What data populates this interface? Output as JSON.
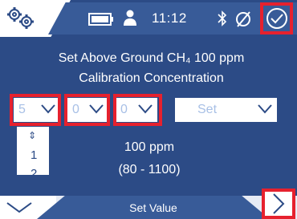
{
  "status_bar": {
    "time": "11:12",
    "icons": [
      "settings-gears-icon",
      "battery-icon",
      "user-icon",
      "bluetooth-icon",
      "no-signal-icon",
      "confirm-check-icon"
    ]
  },
  "message": {
    "line1": "Set Above Ground CH₄ 100 ppm",
    "line2": "Calibration Concentration"
  },
  "dropdowns": [
    {
      "value": "5"
    },
    {
      "value": "0"
    },
    {
      "value": "0"
    },
    {
      "value": "Set"
    }
  ],
  "digit_list": {
    "options": [
      "1",
      "2"
    ]
  },
  "current_value": "100 ppm",
  "range": "(80 - 1100)",
  "bottom_bar": {
    "label": "Set Value"
  },
  "colors": {
    "background": "#2c4b86",
    "highlight": "#e6212e",
    "dropdown_text": "#a8c0e6"
  }
}
